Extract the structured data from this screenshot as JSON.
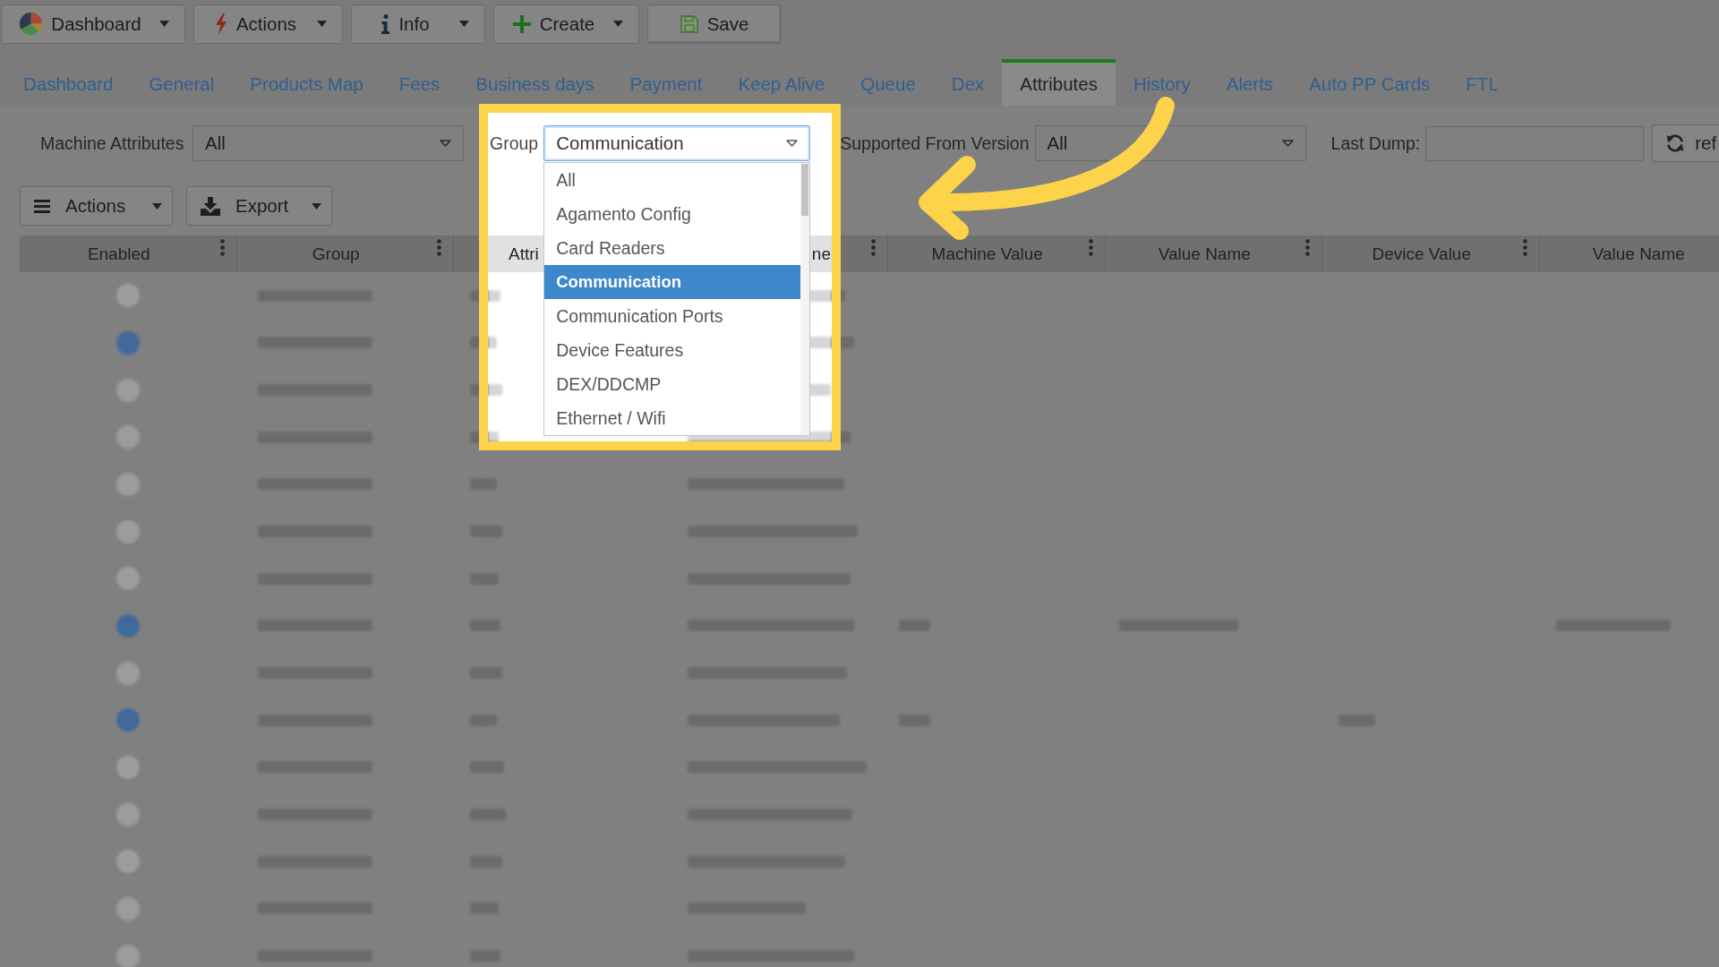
{
  "toolbar": [
    {
      "kind": "dashboard",
      "label": "Dashboard",
      "dropdown": true
    },
    {
      "kind": "actions",
      "label": "Actions",
      "dropdown": true
    },
    {
      "kind": "info",
      "label": "Info",
      "dropdown": true
    },
    {
      "kind": "create",
      "label": "Create",
      "dropdown": true
    },
    {
      "kind": "save",
      "label": "Save",
      "dropdown": false
    }
  ],
  "tabs": [
    {
      "label": "Dashboard",
      "selected": false
    },
    {
      "label": "General",
      "selected": false
    },
    {
      "label": "Products Map",
      "selected": false
    },
    {
      "label": "Fees",
      "selected": false
    },
    {
      "label": "Business days",
      "selected": false
    },
    {
      "label": "Payment",
      "selected": false
    },
    {
      "label": "Keep Alive",
      "selected": false
    },
    {
      "label": "Queue",
      "selected": false
    },
    {
      "label": "Dex",
      "selected": false
    },
    {
      "label": "Attributes",
      "selected": true
    },
    {
      "label": "History",
      "selected": false
    },
    {
      "label": "Alerts",
      "selected": false
    },
    {
      "label": "Auto PP Cards",
      "selected": false
    },
    {
      "label": "FTL",
      "selected": false
    }
  ],
  "filters": [
    {
      "kind": "select",
      "label": "Machine Attributes",
      "value": "All",
      "expanded": false
    },
    {
      "kind": "select",
      "label": "Group",
      "value": "Communication",
      "expanded": true,
      "options": [
        {
          "label": "All",
          "selected": false
        },
        {
          "label": "Agamento Config",
          "selected": false
        },
        {
          "label": "Card Readers",
          "selected": false
        },
        {
          "label": "Communication",
          "selected": true
        },
        {
          "label": "Communication Ports",
          "selected": false
        },
        {
          "label": "Device Features",
          "selected": false
        },
        {
          "label": "DEX/DDCMP",
          "selected": false
        },
        {
          "label": "Ethernet / Wifi",
          "selected": false
        }
      ]
    },
    {
      "kind": "select",
      "label": "Supported From Version",
      "value": "All",
      "expanded": false
    },
    {
      "kind": "input",
      "label": "Last Dump:"
    },
    {
      "kind": "refresh",
      "label": "ref"
    }
  ],
  "grid_actions": [
    {
      "kind": "menu",
      "label": "Actions",
      "dropdown": true
    },
    {
      "kind": "export",
      "label": "Export",
      "dropdown": true
    }
  ],
  "table": {
    "columns": [
      {
        "label": "Enabled",
        "menu": true
      },
      {
        "label": "Group",
        "menu": true
      },
      {
        "label": "Attri",
        "menu": false
      },
      {
        "label": "ne",
        "menu": true
      },
      {
        "label": "Machine Value",
        "menu": true
      },
      {
        "label": "Value Name",
        "menu": true
      },
      {
        "label": "Device Value",
        "menu": true
      },
      {
        "label": "Value Name",
        "menu": false
      }
    ],
    "rows": [
      {
        "enabled": false,
        "kind": "plain"
      },
      {
        "enabled": true,
        "kind": "plain"
      },
      {
        "enabled": false,
        "kind": "plain"
      },
      {
        "enabled": false,
        "kind": "plain"
      },
      {
        "enabled": false,
        "kind": "plain"
      },
      {
        "enabled": false,
        "kind": "plain"
      },
      {
        "enabled": false,
        "kind": "plain"
      },
      {
        "enabled": true,
        "kind": "mapped"
      },
      {
        "enabled": false,
        "kind": "plain"
      },
      {
        "enabled": true,
        "kind": "valued"
      },
      {
        "enabled": false,
        "kind": "plain"
      },
      {
        "enabled": false,
        "kind": "plain"
      },
      {
        "enabled": false,
        "kind": "plain"
      },
      {
        "enabled": false,
        "kind": "plain"
      },
      {
        "enabled": false,
        "kind": "plain"
      }
    ]
  }
}
